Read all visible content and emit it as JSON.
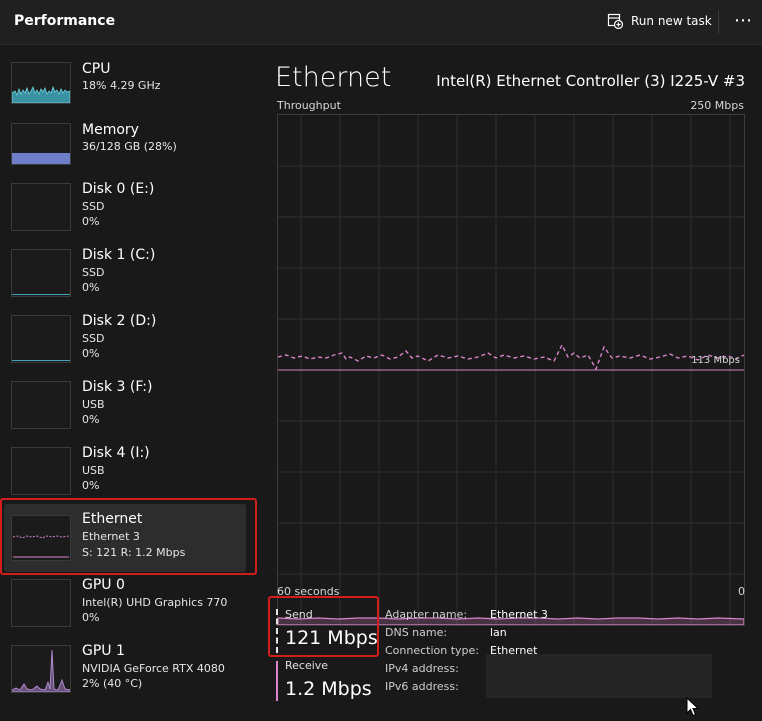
{
  "header": {
    "title": "Performance",
    "run_task_label": "Run new task",
    "more_label": "⋯"
  },
  "sidebar": {
    "items": [
      {
        "name": "CPU",
        "line2": "18% 4.29 GHz",
        "line3": ""
      },
      {
        "name": "Memory",
        "line2": "36/128 GB (28%)",
        "line3": ""
      },
      {
        "name": "Disk 0 (E:)",
        "line2": "SSD",
        "line3": "0%"
      },
      {
        "name": "Disk 1 (C:)",
        "line2": "SSD",
        "line3": "0%"
      },
      {
        "name": "Disk 2 (D:)",
        "line2": "SSD",
        "line3": "0%"
      },
      {
        "name": "Disk 3 (F:)",
        "line2": "USB",
        "line3": "0%"
      },
      {
        "name": "Disk 4 (I:)",
        "line2": "USB",
        "line3": "0%"
      },
      {
        "name": "Ethernet",
        "line2": "Ethernet 3",
        "line3": "S: 121 R: 1.2 Mbps"
      },
      {
        "name": "GPU 0",
        "line2": "Intel(R) UHD Graphics 770",
        "line3": "0%"
      },
      {
        "name": "GPU 1",
        "line2": "NVIDIA GeForce RTX 4080",
        "line3": "2% (40 °C)"
      }
    ]
  },
  "main": {
    "title": "Ethernet",
    "adapter": "Intel(R) Ethernet Controller (3) I225-V #3",
    "throughput_label": "Throughput",
    "max_label": "250 Mbps",
    "scale_label": "113 Mbps",
    "seconds_label": "60 seconds",
    "zero_label": "0",
    "send": {
      "label": "Send",
      "value": "121 Mbps"
    },
    "receive": {
      "label": "Receive",
      "value": "1.2 Mbps"
    },
    "properties": [
      {
        "key": "Adapter name:",
        "value": "Ethernet 3"
      },
      {
        "key": "DNS name:",
        "value": "lan"
      },
      {
        "key": "Connection type:",
        "value": "Ethernet"
      },
      {
        "key": "IPv4 address:",
        "value": ""
      },
      {
        "key": "IPv6 address:",
        "value": ""
      }
    ]
  },
  "colors": {
    "accent_pink": "#d784c9",
    "memory_blue": "#6f7ec9",
    "cpu_teal": "#3fa6b9",
    "highlight_red": "#d21d1d"
  }
}
